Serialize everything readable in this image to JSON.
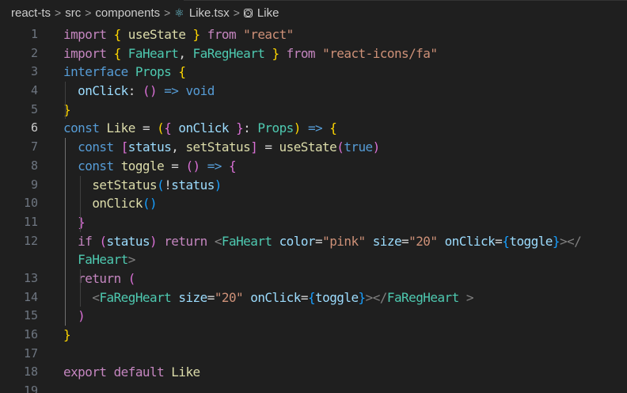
{
  "breadcrumb": {
    "items": [
      {
        "label": "react-ts"
      },
      {
        "label": "src"
      },
      {
        "label": "components"
      },
      {
        "label": "Like.tsx",
        "icon": "react-icon"
      },
      {
        "label": "Like",
        "icon": "symbol-icon"
      }
    ],
    "separator": ">"
  },
  "editor": {
    "active_line": "6",
    "lines": [
      {
        "n": "1",
        "tokens": [
          [
            "k",
            "import"
          ],
          [
            "p",
            " "
          ],
          [
            "br1",
            "{"
          ],
          [
            "p",
            " "
          ],
          [
            "f",
            "useState"
          ],
          [
            "p",
            " "
          ],
          [
            "br1",
            "}"
          ],
          [
            "p",
            " "
          ],
          [
            "k",
            "from"
          ],
          [
            "p",
            " "
          ],
          [
            "s",
            "\"react\""
          ]
        ]
      },
      {
        "n": "2",
        "tokens": [
          [
            "k",
            "import"
          ],
          [
            "p",
            " "
          ],
          [
            "br1",
            "{"
          ],
          [
            "p",
            " "
          ],
          [
            "t",
            "FaHeart"
          ],
          [
            "p",
            ", "
          ],
          [
            "t",
            "FaRegHeart"
          ],
          [
            "p",
            " "
          ],
          [
            "br1",
            "}"
          ],
          [
            "p",
            " "
          ],
          [
            "k",
            "from"
          ],
          [
            "p",
            " "
          ],
          [
            "s",
            "\"react-icons/fa\""
          ]
        ]
      },
      {
        "n": "3",
        "tokens": [
          [
            "sk",
            "interface"
          ],
          [
            "p",
            " "
          ],
          [
            "t",
            "Props"
          ],
          [
            "p",
            " "
          ],
          [
            "br1",
            "{"
          ]
        ]
      },
      {
        "n": "4",
        "tokens": [
          [
            "p",
            "  "
          ],
          [
            "v",
            "onClick"
          ],
          [
            "p",
            ": "
          ],
          [
            "br2",
            "()"
          ],
          [
            "p",
            " "
          ],
          [
            "sk",
            "=>"
          ],
          [
            "p",
            " "
          ],
          [
            "sk",
            "void"
          ]
        ]
      },
      {
        "n": "5",
        "tokens": [
          [
            "br1",
            "}"
          ]
        ]
      },
      {
        "n": "6",
        "tokens": [
          [
            "sk",
            "const"
          ],
          [
            "p",
            " "
          ],
          [
            "f",
            "Like"
          ],
          [
            "p",
            " = "
          ],
          [
            "br1",
            "("
          ],
          [
            "br2",
            "{"
          ],
          [
            "p",
            " "
          ],
          [
            "v",
            "onClick"
          ],
          [
            "p",
            " "
          ],
          [
            "br2",
            "}"
          ],
          [
            "p",
            ": "
          ],
          [
            "t",
            "Props"
          ],
          [
            "br1",
            ")"
          ],
          [
            "p",
            " "
          ],
          [
            "sk",
            "=>"
          ],
          [
            "p",
            " "
          ],
          [
            "br1",
            "{"
          ]
        ]
      },
      {
        "n": "7",
        "tokens": [
          [
            "p",
            "  "
          ],
          [
            "sk",
            "const"
          ],
          [
            "p",
            " "
          ],
          [
            "br2",
            "["
          ],
          [
            "v",
            "status"
          ],
          [
            "p",
            ", "
          ],
          [
            "f",
            "setStatus"
          ],
          [
            "br2",
            "]"
          ],
          [
            "p",
            " = "
          ],
          [
            "f",
            "useState"
          ],
          [
            "br2",
            "("
          ],
          [
            "sk",
            "true"
          ],
          [
            "br2",
            ")"
          ]
        ]
      },
      {
        "n": "8",
        "tokens": [
          [
            "p",
            "  "
          ],
          [
            "sk",
            "const"
          ],
          [
            "p",
            " "
          ],
          [
            "f",
            "toggle"
          ],
          [
            "p",
            " = "
          ],
          [
            "br2",
            "()"
          ],
          [
            "p",
            " "
          ],
          [
            "sk",
            "=>"
          ],
          [
            "p",
            " "
          ],
          [
            "br2",
            "{"
          ]
        ]
      },
      {
        "n": "9",
        "tokens": [
          [
            "p",
            "    "
          ],
          [
            "f",
            "setStatus"
          ],
          [
            "br3",
            "("
          ],
          [
            "p",
            "!"
          ],
          [
            "v",
            "status"
          ],
          [
            "br3",
            ")"
          ]
        ]
      },
      {
        "n": "10",
        "tokens": [
          [
            "p",
            "    "
          ],
          [
            "f",
            "onClick"
          ],
          [
            "br3",
            "()"
          ]
        ]
      },
      {
        "n": "11",
        "tokens": [
          [
            "p",
            "  "
          ],
          [
            "br2",
            "}"
          ]
        ]
      },
      {
        "n": "12",
        "tokens": [
          [
            "p",
            "  "
          ],
          [
            "k",
            "if"
          ],
          [
            "p",
            " "
          ],
          [
            "br2",
            "("
          ],
          [
            "v",
            "status"
          ],
          [
            "br2",
            ")"
          ],
          [
            "p",
            " "
          ],
          [
            "k",
            "return"
          ],
          [
            "p",
            " "
          ],
          [
            "tg",
            "<"
          ],
          [
            "t",
            "FaHeart"
          ],
          [
            "p",
            " "
          ],
          [
            "v",
            "color"
          ],
          [
            "p",
            "="
          ],
          [
            "s",
            "\"pink\""
          ],
          [
            "p",
            " "
          ],
          [
            "v",
            "size"
          ],
          [
            "p",
            "="
          ],
          [
            "s",
            "\"20\""
          ],
          [
            "p",
            " "
          ],
          [
            "v",
            "onClick"
          ],
          [
            "p",
            "="
          ],
          [
            "br3",
            "{"
          ],
          [
            "v",
            "toggle"
          ],
          [
            "br3",
            "}"
          ],
          [
            "tg",
            "></"
          ]
        ]
      },
      {
        "n": "",
        "tokens": [
          [
            "p",
            "  "
          ],
          [
            "t",
            "FaHeart"
          ],
          [
            "tg",
            ">"
          ]
        ]
      },
      {
        "n": "13",
        "tokens": [
          [
            "p",
            "  "
          ],
          [
            "k",
            "return"
          ],
          [
            "p",
            " "
          ],
          [
            "br2",
            "("
          ]
        ]
      },
      {
        "n": "14",
        "tokens": [
          [
            "p",
            "    "
          ],
          [
            "tg",
            "<"
          ],
          [
            "t",
            "FaRegHeart"
          ],
          [
            "p",
            " "
          ],
          [
            "v",
            "size"
          ],
          [
            "p",
            "="
          ],
          [
            "s",
            "\"20\""
          ],
          [
            "p",
            " "
          ],
          [
            "v",
            "onClick"
          ],
          [
            "p",
            "="
          ],
          [
            "br3",
            "{"
          ],
          [
            "v",
            "toggle"
          ],
          [
            "br3",
            "}"
          ],
          [
            "tg",
            "></"
          ],
          [
            "t",
            "FaRegHeart"
          ],
          [
            "p",
            " "
          ],
          [
            "tg",
            ">"
          ]
        ]
      },
      {
        "n": "15",
        "tokens": [
          [
            "p",
            "  "
          ],
          [
            "br2",
            ")"
          ]
        ]
      },
      {
        "n": "16",
        "tokens": [
          [
            "br1",
            "}"
          ]
        ]
      },
      {
        "n": "17",
        "tokens": []
      },
      {
        "n": "18",
        "tokens": [
          [
            "k",
            "export"
          ],
          [
            "p",
            " "
          ],
          [
            "k",
            "default"
          ],
          [
            "p",
            " "
          ],
          [
            "f",
            "Like"
          ]
        ]
      },
      {
        "n": "19",
        "tokens": []
      }
    ]
  }
}
